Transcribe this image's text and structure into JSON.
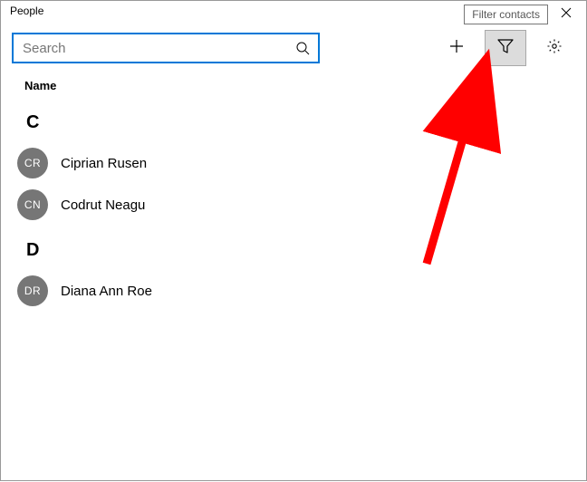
{
  "window": {
    "title": "People"
  },
  "tooltip": {
    "text": "Filter contacts"
  },
  "search": {
    "placeholder": "Search",
    "value": ""
  },
  "list": {
    "column_header": "Name",
    "groups": [
      {
        "letter": "C",
        "contacts": [
          {
            "initials": "CR",
            "name": "Ciprian Rusen"
          },
          {
            "initials": "CN",
            "name": "Codrut Neagu"
          }
        ]
      },
      {
        "letter": "D",
        "contacts": [
          {
            "initials": "DR",
            "name": "Diana Ann Roe"
          }
        ]
      }
    ]
  }
}
